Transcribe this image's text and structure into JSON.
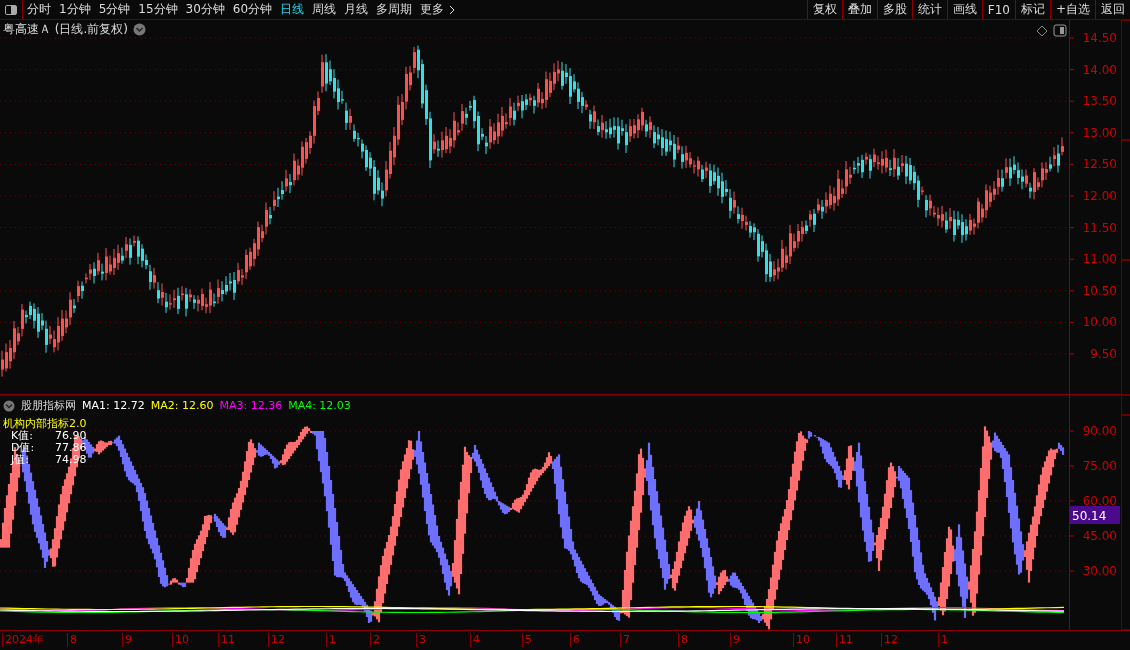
{
  "toolbar": {
    "periods": [
      {
        "label": "分时",
        "selected": false
      },
      {
        "label": "1分钟",
        "selected": false
      },
      {
        "label": "5分钟",
        "selected": false
      },
      {
        "label": "15分钟",
        "selected": false
      },
      {
        "label": "30分钟",
        "selected": false
      },
      {
        "label": "60分钟",
        "selected": false
      },
      {
        "label": "日线",
        "selected": true
      },
      {
        "label": "周线",
        "selected": false
      },
      {
        "label": "月线",
        "selected": false
      },
      {
        "label": "多周期",
        "selected": false
      }
    ],
    "more": "更多",
    "buttons": [
      "复权",
      "叠加",
      "多股",
      "统计",
      "画线",
      "F10",
      "标记",
      "+自选",
      "返回"
    ]
  },
  "price_chart": {
    "title": "粤高速Ａ (日线.前复权)",
    "yticks": [
      "14.50",
      "14.00",
      "13.50",
      "13.00",
      "12.50",
      "12.00",
      "11.50",
      "11.00",
      "10.50",
      "10.00",
      "9.50"
    ]
  },
  "indicator": {
    "source": "股朋指标网",
    "ma": [
      {
        "label": "MA1:",
        "value": "12.72",
        "color": "#ffffff"
      },
      {
        "label": "MA2:",
        "value": "12.60",
        "color": "#ffff00"
      },
      {
        "label": "MA3:",
        "value": "12.36",
        "color": "#ff00ff"
      },
      {
        "label": "MA4:",
        "value": "12.03",
        "color": "#00ff00"
      }
    ],
    "name": "机构内部指标2.0",
    "values": [
      {
        "label": "K值:",
        "value": "76.90"
      },
      {
        "label": "D值:",
        "value": "77.86"
      },
      {
        "label": "J值:",
        "value": "74.98"
      }
    ],
    "yticks": [
      "90.00",
      "75.00",
      "60.00",
      "45.00",
      "30.00"
    ],
    "current": "50.14"
  },
  "date_axis": [
    "2024年",
    "8",
    "9",
    "10",
    "11",
    "12",
    "1",
    "2",
    "3",
    "4",
    "5",
    "6",
    "7",
    "8",
    "9",
    "10",
    "11",
    "12",
    "1"
  ]
}
